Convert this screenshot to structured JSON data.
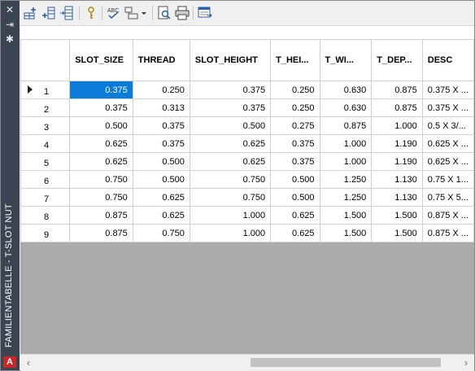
{
  "window": {
    "title": "FAMILIENTABELLE - T-SLOT NUT"
  },
  "icons": {
    "close": "close-icon",
    "autohide": "autohide-icon",
    "properties": "gear-icon",
    "app_logo_text": "A"
  },
  "toolbar": {
    "buttons": [
      {
        "name": "insert-row-icon"
      },
      {
        "name": "insert-column-icon"
      },
      {
        "name": "column-properties-icon"
      },
      {
        "name": "key-icon"
      },
      {
        "name": "spellcheck-icon"
      },
      {
        "name": "layout-dropdown-icon"
      },
      {
        "name": "find-icon"
      },
      {
        "name": "print-icon"
      },
      {
        "name": "export-icon"
      }
    ]
  },
  "grid": {
    "columns": [
      "",
      "SLOT_SIZE",
      "THREAD",
      "SLOT_HEIGHT",
      "T_HEI...",
      "T_WI...",
      "T_DEP...",
      "DESC"
    ],
    "rows": [
      {
        "idx": "1",
        "slot_size": "0.375",
        "thread": "0.250",
        "slot_height": "0.375",
        "t_height": "0.250",
        "t_width": "0.630",
        "t_depth": "0.875",
        "desc": "0.375 X ..."
      },
      {
        "idx": "2",
        "slot_size": "0.375",
        "thread": "0.313",
        "slot_height": "0.375",
        "t_height": "0.250",
        "t_width": "0.630",
        "t_depth": "0.875",
        "desc": "0.375 X ..."
      },
      {
        "idx": "3",
        "slot_size": "0.500",
        "thread": "0.375",
        "slot_height": "0.500",
        "t_height": "0.275",
        "t_width": "0.875",
        "t_depth": "1.000",
        "desc": "0.5 X 3/..."
      },
      {
        "idx": "4",
        "slot_size": "0.625",
        "thread": "0.375",
        "slot_height": "0.625",
        "t_height": "0.375",
        "t_width": "1.000",
        "t_depth": "1.190",
        "desc": "0.625 X ..."
      },
      {
        "idx": "5",
        "slot_size": "0.625",
        "thread": "0.500",
        "slot_height": "0.625",
        "t_height": "0.375",
        "t_width": "1.000",
        "t_depth": "1.190",
        "desc": "0.625 X ..."
      },
      {
        "idx": "6",
        "slot_size": "0.750",
        "thread": "0.500",
        "slot_height": "0.750",
        "t_height": "0.500",
        "t_width": "1.250",
        "t_depth": "1.130",
        "desc": "0.75 X 1..."
      },
      {
        "idx": "7",
        "slot_size": "0.750",
        "thread": "0.625",
        "slot_height": "0.750",
        "t_height": "0.500",
        "t_width": "1.250",
        "t_depth": "1.130",
        "desc": "0.75 X 5..."
      },
      {
        "idx": "8",
        "slot_size": "0.875",
        "thread": "0.625",
        "slot_height": "1.000",
        "t_height": "0.625",
        "t_width": "1.500",
        "t_depth": "1.500",
        "desc": "0.875 X ..."
      },
      {
        "idx": "9",
        "slot_size": "0.875",
        "thread": "0.750",
        "slot_height": "1.000",
        "t_height": "0.625",
        "t_width": "1.500",
        "t_depth": "1.500",
        "desc": "0.875 X ..."
      }
    ],
    "selected_row": 1,
    "selected_column": "SLOT_SIZE"
  },
  "colors": {
    "title_bar": "#3b4453",
    "selection": "#0a7bd6",
    "empty_area": "#ababab"
  }
}
